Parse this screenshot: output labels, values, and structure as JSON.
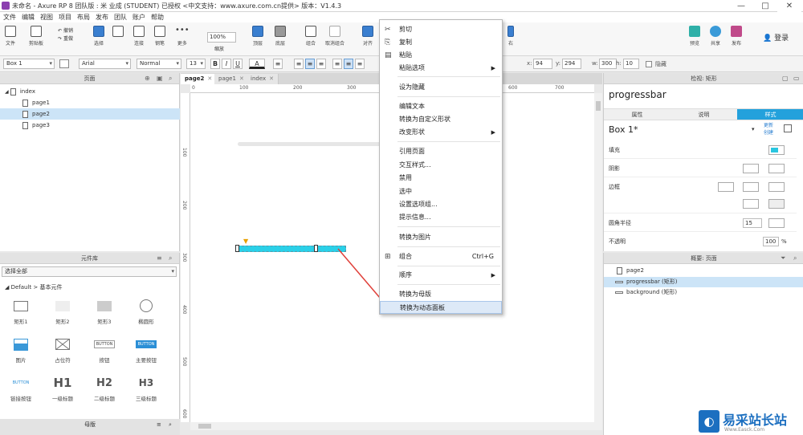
{
  "window": {
    "title": "未命名 - Axure RP 8 团队版 : 米 业成 (STUDENT) 已授权    <中文支持：www.axure.com.cn提供> 版本：V1.4.3",
    "controls": [
      "—",
      "□",
      "✕"
    ]
  },
  "menubar": [
    "文件",
    "编辑",
    "视图",
    "项目",
    "布局",
    "发布",
    "团队",
    "账户",
    "帮助"
  ],
  "toolbar": {
    "file": "文件",
    "clipboard": "剪贴板",
    "undo": "撤销",
    "redo": "重做",
    "select": "选择",
    "connect": "连接",
    "pen": "钢笔",
    "more": "更多",
    "zoom_value": "100%",
    "zoom": "缩放",
    "top": "顶层",
    "bottom": "底层",
    "group": "组合",
    "ungroup": "取消组合",
    "align": "对齐",
    "right": "右",
    "preview": "预览",
    "share": "共享",
    "publish": "发布",
    "login": "登录"
  },
  "formatbar": {
    "widget_name": "Box 1",
    "font": "Arial",
    "style": "Normal",
    "size": "13",
    "bold": "B",
    "italic": "I",
    "underline": "U",
    "font_color": "A",
    "x_label": "x:",
    "x": "94",
    "y_label": "y:",
    "y": "294",
    "w_label": "w:",
    "w": "300",
    "h_label": "h:",
    "h": "10",
    "hidden": "隐藏"
  },
  "pages_panel": {
    "title": "页面",
    "root": "index",
    "pages": [
      "page1",
      "page2",
      "page3"
    ],
    "selected": "page2"
  },
  "library_panel": {
    "title": "元件库",
    "library": "选择全部",
    "group": "Default > 基本元件",
    "widgets": [
      "矩形1",
      "矩形2",
      "矩形3",
      "椭圆形",
      "图片",
      "占位符",
      "按钮",
      "主要按钮",
      "链接按钮",
      "一级标题",
      "二级标题",
      "三级标题"
    ],
    "button_text": "BUTTON",
    "h1": "H1",
    "h2": "H2",
    "h3": "H3"
  },
  "masters_panel": {
    "title": "母版"
  },
  "tabs": [
    {
      "label": "page2",
      "active": true
    },
    {
      "label": "page1",
      "active": false
    },
    {
      "label": "index",
      "active": false
    }
  ],
  "rulers": {
    "h": [
      "0",
      "100",
      "200",
      "300",
      "400",
      "500",
      "600",
      "700"
    ],
    "v": [
      "100",
      "200",
      "300",
      "400",
      "500",
      "600"
    ]
  },
  "context_menu": {
    "items": [
      {
        "label": "剪切",
        "icon": "cut-icon",
        "glyph": "✂"
      },
      {
        "label": "复制",
        "icon": "copy-icon",
        "glyph": "⎘"
      },
      {
        "label": "粘贴",
        "icon": "paste-icon",
        "glyph": "▤"
      },
      {
        "label": "粘贴选项",
        "submenu": true
      },
      {
        "label": "设为隐藏"
      },
      {
        "label": "编辑文本"
      },
      {
        "label": "转换为自定义形状"
      },
      {
        "label": "改变形状",
        "submenu": true
      },
      {
        "label": "引用页面"
      },
      {
        "label": "交互样式..."
      },
      {
        "label": "禁用"
      },
      {
        "label": "选中"
      },
      {
        "label": "设置选项组..."
      },
      {
        "label": "提示信息..."
      },
      {
        "label": "转换为图片"
      },
      {
        "label": "组合",
        "shortcut": "Ctrl+G",
        "icon": "group-icon",
        "glyph": "⊞"
      },
      {
        "label": "顺序",
        "submenu": true
      },
      {
        "label": "转换为母版"
      },
      {
        "label": "转换为动态面板",
        "highlighted": true
      }
    ]
  },
  "inspector": {
    "header": "检视: 矩形",
    "name": "progressbar",
    "tabs": [
      "属性",
      "说明",
      "样式"
    ],
    "active_tab": "样式",
    "style_name": "Box 1*",
    "update": "更新",
    "create": "创建",
    "fill": "填充",
    "shadow": "阴影",
    "border": "边框",
    "radius": "圆角半径",
    "radius_value": "15",
    "opacity": "不透明",
    "opacity_value": "100",
    "percent": "%",
    "fill_color": "#29c6e0"
  },
  "outline": {
    "title": "概要: 页面",
    "page": "page2",
    "items": [
      "progressbar (矩形)",
      "background (矩形)"
    ],
    "selected": "progressbar (矩形)"
  },
  "canvas": {
    "bar_color": "#2ad0e8",
    "track_color": "#e6e6e6",
    "progress": 0.58,
    "arrow_color": "#e0403a"
  },
  "watermark": {
    "text": "易采站长站",
    "sub": "Www.Easck.Com"
  }
}
